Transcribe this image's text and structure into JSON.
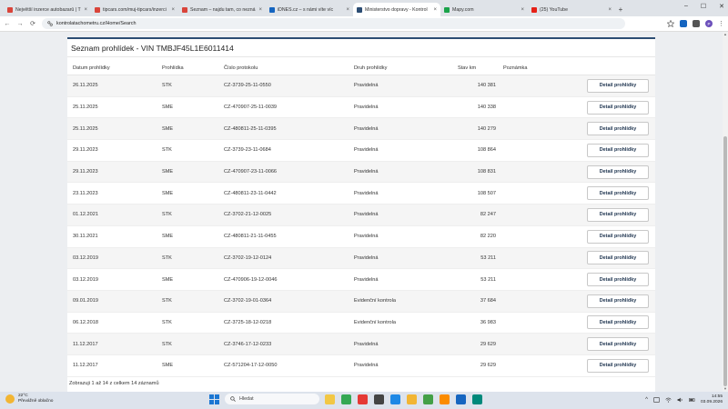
{
  "browser": {
    "tabs": [
      {
        "label": "Největší inzerce autobazarů | T",
        "favicon_color": "#d9443a",
        "active": false
      },
      {
        "label": "tipcars.com/muj-tipcars/inzerci",
        "favicon_color": "#d9443a",
        "active": false
      },
      {
        "label": "Seznam – najdu tam, co nezná",
        "favicon_color": "#d9443a",
        "active": false
      },
      {
        "label": "iDNES.cz – s námi víte víc",
        "favicon_color": "#1565c0",
        "active": false
      },
      {
        "label": "Ministerstvo dopravy - Kontrol",
        "favicon_color": "#2c4d73",
        "active": true
      },
      {
        "label": "Mapy.com",
        "favicon_color": "#1aa34a",
        "active": false
      },
      {
        "label": "(25) YouTube",
        "favicon_color": "#e62117",
        "active": false
      }
    ],
    "new_tab": "+",
    "window_controls": [
      "–",
      "☐",
      "✕"
    ],
    "url": "kontrolatachometru.cz/Home/Search",
    "nav": {
      "back": "←",
      "forward": "→",
      "reload": "⟳"
    },
    "profile_initial": "P"
  },
  "page": {
    "title": "Seznam prohlídek - VIN TMBJF45L1E6011414",
    "columns": [
      "Datum prohlídky",
      "Prohlídka",
      "Číslo protokolu",
      "Druh prohlídky",
      "Stav km",
      "Poznámka"
    ],
    "detail_label": "Detail prohlídky",
    "rows": [
      {
        "date": "26.11.2025",
        "type": "STK",
        "protocol": "CZ-3739-25-11-0550",
        "kind": "Pravidelná",
        "km": "140 381",
        "note": ""
      },
      {
        "date": "25.11.2025",
        "type": "SME",
        "protocol": "CZ-470907-25-11-0039",
        "kind": "Pravidelná",
        "km": "140 338",
        "note": ""
      },
      {
        "date": "25.11.2025",
        "type": "SME",
        "protocol": "CZ-480811-25-11-0395",
        "kind": "Pravidelná",
        "km": "140 279",
        "note": ""
      },
      {
        "date": "29.11.2023",
        "type": "STK",
        "protocol": "CZ-3739-23-11-0684",
        "kind": "Pravidelná",
        "km": "108 864",
        "note": ""
      },
      {
        "date": "29.11.2023",
        "type": "SME",
        "protocol": "CZ-470907-23-11-0066",
        "kind": "Pravidelná",
        "km": "108 831",
        "note": ""
      },
      {
        "date": "23.11.2023",
        "type": "SME",
        "protocol": "CZ-480811-23-11-0442",
        "kind": "Pravidelná",
        "km": "108 507",
        "note": ""
      },
      {
        "date": "01.12.2021",
        "type": "STK",
        "protocol": "CZ-3702-21-12-0025",
        "kind": "Pravidelná",
        "km": "82 247",
        "note": ""
      },
      {
        "date": "30.11.2021",
        "type": "SME",
        "protocol": "CZ-480811-21-11-0455",
        "kind": "Pravidelná",
        "km": "82 220",
        "note": ""
      },
      {
        "date": "03.12.2019",
        "type": "STK",
        "protocol": "CZ-3702-19-12-0124",
        "kind": "Pravidelná",
        "km": "53 211",
        "note": ""
      },
      {
        "date": "03.12.2019",
        "type": "SME",
        "protocol": "CZ-470906-19-12-0046",
        "kind": "Pravidelná",
        "km": "53 211",
        "note": ""
      },
      {
        "date": "09.01.2019",
        "type": "STK",
        "protocol": "CZ-3702-19-01-0364",
        "kind": "Evidenční kontrola",
        "km": "37 684",
        "note": ""
      },
      {
        "date": "06.12.2018",
        "type": "STK",
        "protocol": "CZ-3725-18-12-0218",
        "kind": "Evidenční kontrola",
        "km": "36 983",
        "note": ""
      },
      {
        "date": "11.12.2017",
        "type": "STK",
        "protocol": "CZ-3746-17-12-0233",
        "kind": "Pravidelná",
        "km": "29 629",
        "note": ""
      },
      {
        "date": "11.12.2017",
        "type": "SME",
        "protocol": "CZ-571204-17-12-0050",
        "kind": "Pravidelná",
        "km": "29 629",
        "note": ""
      }
    ],
    "footer": "Zobrazuji 1 až 14 z celkem 14 záznamů"
  },
  "taskbar": {
    "weather_temp": "22°C",
    "weather_desc": "Převážně oblačno",
    "search_placeholder": "Hledat",
    "apps": [
      {
        "name": "file-explorer",
        "color": "#f2c744"
      },
      {
        "name": "chrome",
        "color": "#34a853"
      },
      {
        "name": "app-red",
        "color": "#e53935"
      },
      {
        "name": "app-dark",
        "color": "#444444"
      },
      {
        "name": "edge",
        "color": "#1e88e5"
      },
      {
        "name": "folder",
        "color": "#f2b533"
      },
      {
        "name": "app-green",
        "color": "#43a047"
      },
      {
        "name": "app-orange",
        "color": "#fb8c00"
      },
      {
        "name": "app-blue",
        "color": "#1565c0"
      },
      {
        "name": "app-teal",
        "color": "#00897b"
      }
    ],
    "tray_chevron": "^",
    "time": "14:55",
    "date": "03.09.2026"
  },
  "colors": {
    "accent": "#2c4d73",
    "button_text": "#1f3550"
  }
}
